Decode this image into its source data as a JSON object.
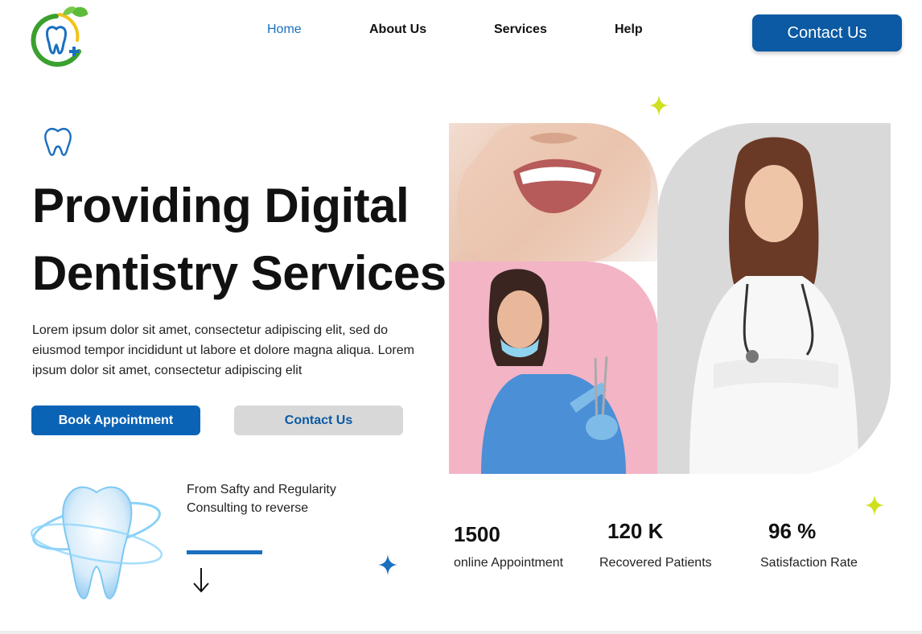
{
  "nav": {
    "items": [
      {
        "label": "Home",
        "active": true
      },
      {
        "label": "About Us",
        "active": false
      },
      {
        "label": "Services",
        "active": false
      },
      {
        "label": "Help",
        "active": false
      }
    ],
    "cta_label": "Contact Us"
  },
  "hero": {
    "title_line1": "Providing Digital",
    "title_line2": "Dentistry Services",
    "description": "Lorem ipsum dolor sit amet, consectetur adipiscing elit, sed do eiusmod tempor incididunt ut labore et dolore magna aliqua. Lorem ipsum dolor sit amet, consectetur adipiscing elit",
    "book_label": "Book Appointment",
    "contact_label": "Contact Us"
  },
  "feature": {
    "text": "From Safty and Regularity Consulting to reverse"
  },
  "stats": [
    {
      "value": "1500",
      "label": "online Appointment"
    },
    {
      "value": "120 K",
      "label": "Recovered Patients"
    },
    {
      "value": "96 %",
      "label": "Satisfaction Rate"
    }
  ],
  "colors": {
    "primary": "#0b5aa3",
    "accent": "#1a6fbf",
    "spark_yellow": "#cfe01e",
    "spark_blue": "#1a6fbf",
    "button_grey": "#d8d8d8",
    "pink_bg": "#f3b4c6",
    "grey_bg": "#d9d9d9"
  },
  "icons": {
    "logo": "tooth-leaf-logo-icon",
    "hero_icon": "tooth-outline-icon",
    "feature_image": "glowing-tooth-icon",
    "arrow": "arrow-down-icon",
    "sparkle": "sparkle-icon"
  }
}
